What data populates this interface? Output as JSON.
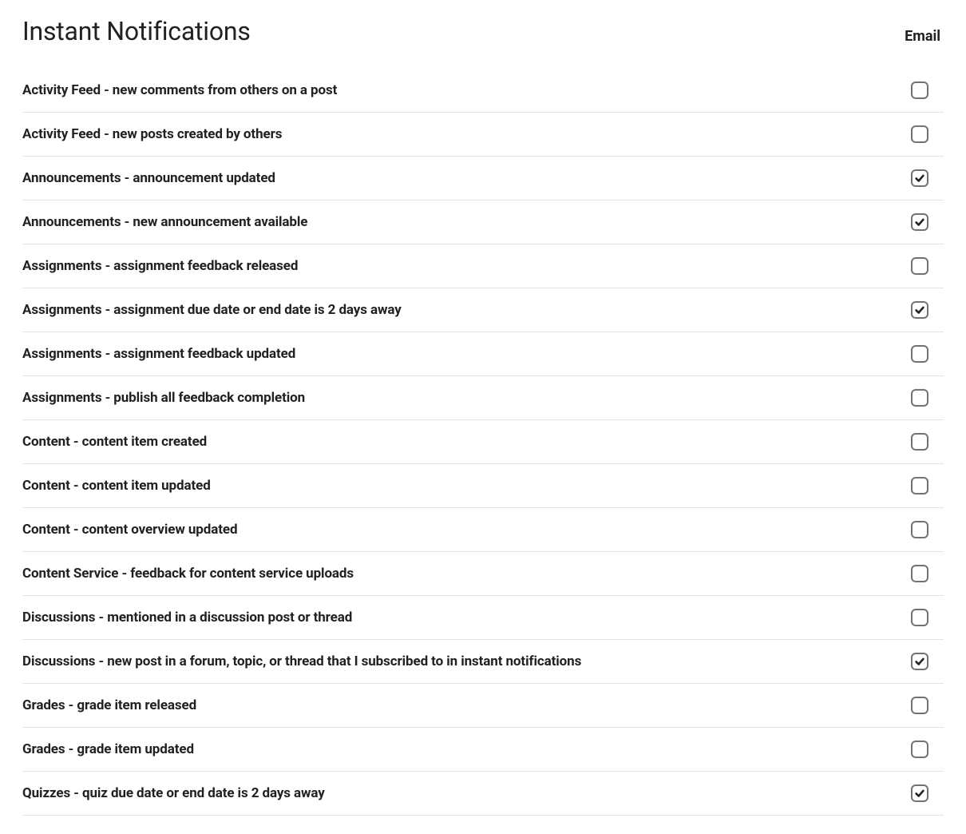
{
  "page": {
    "title": "Instant Notifications",
    "columnHeader": "Email"
  },
  "notifications": [
    {
      "label": "Activity Feed - new comments from others on a post",
      "checked": false
    },
    {
      "label": "Activity Feed - new posts created by others",
      "checked": false
    },
    {
      "label": "Announcements - announcement updated",
      "checked": true
    },
    {
      "label": "Announcements - new announcement available",
      "checked": true
    },
    {
      "label": "Assignments - assignment feedback released",
      "checked": false
    },
    {
      "label": "Assignments - assignment due date or end date is 2 days away",
      "checked": true
    },
    {
      "label": "Assignments - assignment feedback updated",
      "checked": false
    },
    {
      "label": "Assignments - publish all feedback completion",
      "checked": false
    },
    {
      "label": "Content - content item created",
      "checked": false
    },
    {
      "label": "Content - content item updated",
      "checked": false
    },
    {
      "label": "Content - content overview updated",
      "checked": false
    },
    {
      "label": "Content Service - feedback for content service uploads",
      "checked": false
    },
    {
      "label": "Discussions - mentioned in a discussion post or thread",
      "checked": false
    },
    {
      "label": "Discussions - new post in a forum, topic, or thread that I subscribed to in instant notifications",
      "checked": true
    },
    {
      "label": "Grades - grade item released",
      "checked": false
    },
    {
      "label": "Grades - grade item updated",
      "checked": false
    },
    {
      "label": "Quizzes - quiz due date or end date is 2 days away",
      "checked": true
    }
  ]
}
